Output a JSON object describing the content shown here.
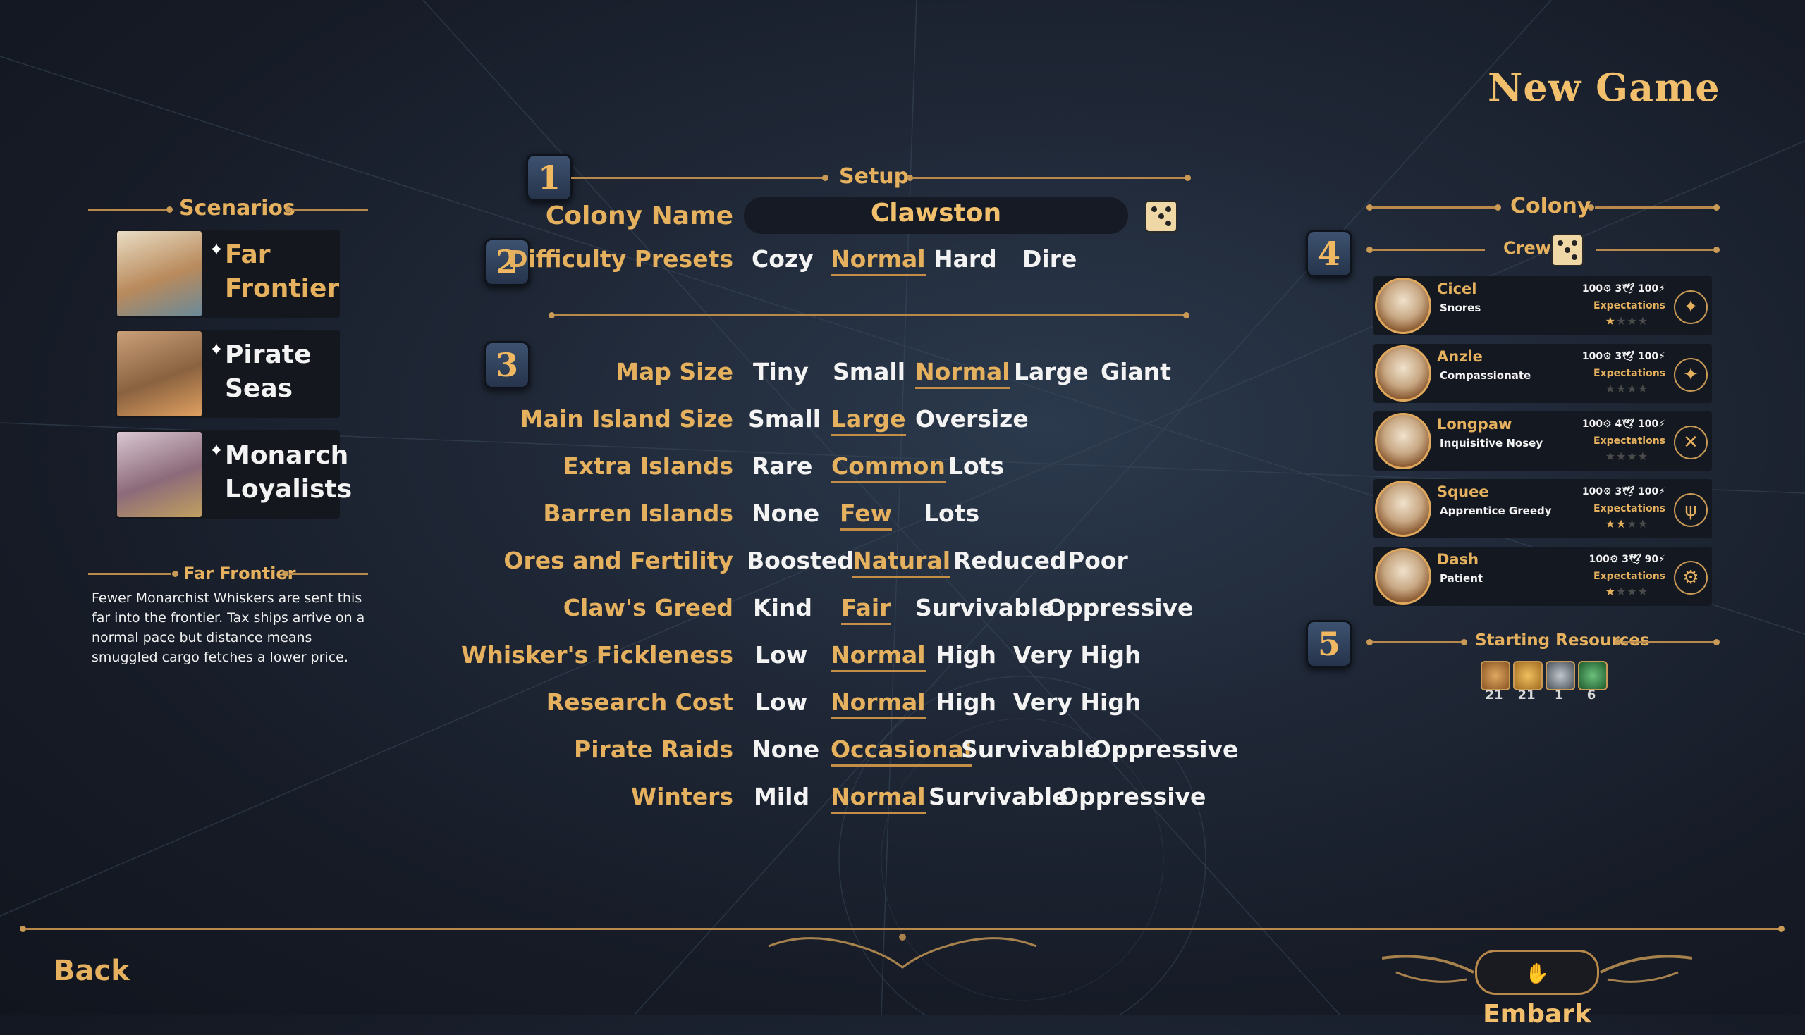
{
  "title": "New Game",
  "scenarios": {
    "header": "Scenarios",
    "items": [
      {
        "label": "Far Frontier"
      },
      {
        "label": "Pirate Seas"
      },
      {
        "label": "Monarch Loyalists"
      }
    ],
    "star": "✦",
    "selected_title": "Far Frontier",
    "description": "Fewer Monarchist Whiskers are sent this far into the frontier. Tax ships arrive on a normal pace but distance means smuggled cargo fetches a lower price."
  },
  "badges": [
    "1",
    "2",
    "3",
    "4",
    "5"
  ],
  "setup": {
    "header": "Setup",
    "colony_name_label": "Colony Name",
    "colony_name": "Clawston",
    "difficulty_label": "Difficulty Presets",
    "difficulty_options": [
      "Cozy",
      "Normal",
      "Hard",
      "Dire"
    ],
    "difficulty_selected": "Normal"
  },
  "settings": [
    {
      "label": "Map Size",
      "options": [
        "Tiny",
        "Small",
        "Normal",
        "Large",
        "Giant"
      ],
      "selected": "Normal"
    },
    {
      "label": "Main Island Size",
      "options": [
        "Small",
        "Large",
        "Oversize"
      ],
      "selected": "Large"
    },
    {
      "label": "Extra Islands",
      "options": [
        "Rare",
        "Common",
        "Lots"
      ],
      "selected": "Common"
    },
    {
      "label": "Barren Islands",
      "options": [
        "None",
        "Few",
        "Lots"
      ],
      "selected": "Few"
    },
    {
      "label": "Ores and Fertility",
      "options": [
        "Boosted",
        "Natural",
        "Reduced",
        "Poor"
      ],
      "selected": "Natural"
    },
    {
      "label": "Claw's Greed",
      "options": [
        "Kind",
        "Fair",
        "Survivable",
        "Oppressive"
      ],
      "selected": "Fair"
    },
    {
      "label": "Whisker's Fickleness",
      "options": [
        "Low",
        "Normal",
        "High",
        "Very High"
      ],
      "selected": "Normal"
    },
    {
      "label": "Research Cost",
      "options": [
        "Low",
        "Normal",
        "High",
        "Very High"
      ],
      "selected": "Normal"
    },
    {
      "label": "Pirate Raids",
      "options": [
        "None",
        "Occasional",
        "Survivable",
        "Oppressive"
      ],
      "selected": "Occasional"
    },
    {
      "label": "Winters",
      "options": [
        "Mild",
        "Normal",
        "Survivable",
        "Oppressive"
      ],
      "selected": "Normal"
    }
  ],
  "colony": {
    "header": "Colony",
    "crew_header": "Crew",
    "expectations_label": "Expectations",
    "crew": [
      {
        "name": "Cicel",
        "traits": "Snores",
        "stats": "100⚙ 3🕊 100⚡",
        "stars": 1,
        "role_icon": "compass-icon"
      },
      {
        "name": "Anzle",
        "traits": "Compassionate",
        "stats": "100⚙ 3🕊 100⚡",
        "stars": 0,
        "role_icon": "compass-icon"
      },
      {
        "name": "Longpaw",
        "traits": "Inquisitive  Nosey",
        "stats": "100⚙ 4🕊 100⚡",
        "stars": 0,
        "role_icon": "crossed-tools-icon"
      },
      {
        "name": "Squee",
        "traits": "Apprentice  Greedy",
        "stats": "100⚙ 3🕊 100⚡",
        "stars": 2,
        "role_icon": "wheat-icon"
      },
      {
        "name": "Dash",
        "traits": "Patient",
        "stats": "100⚙ 3🕊 90⚡",
        "stars": 1,
        "role_icon": "gear-icon"
      }
    ],
    "resources_header": "Starting Resources",
    "resources": [
      {
        "icon": "bread-icon",
        "count": "21",
        "color": "#c8823c"
      },
      {
        "icon": "grain-icon",
        "count": "21",
        "color": "#d49a3c"
      },
      {
        "icon": "gear-part-icon",
        "count": "1",
        "color": "#7b8088"
      },
      {
        "icon": "herb-icon",
        "count": "6",
        "color": "#3c8a4c"
      }
    ]
  },
  "nav": {
    "back": "Back",
    "embark": "Embark"
  }
}
